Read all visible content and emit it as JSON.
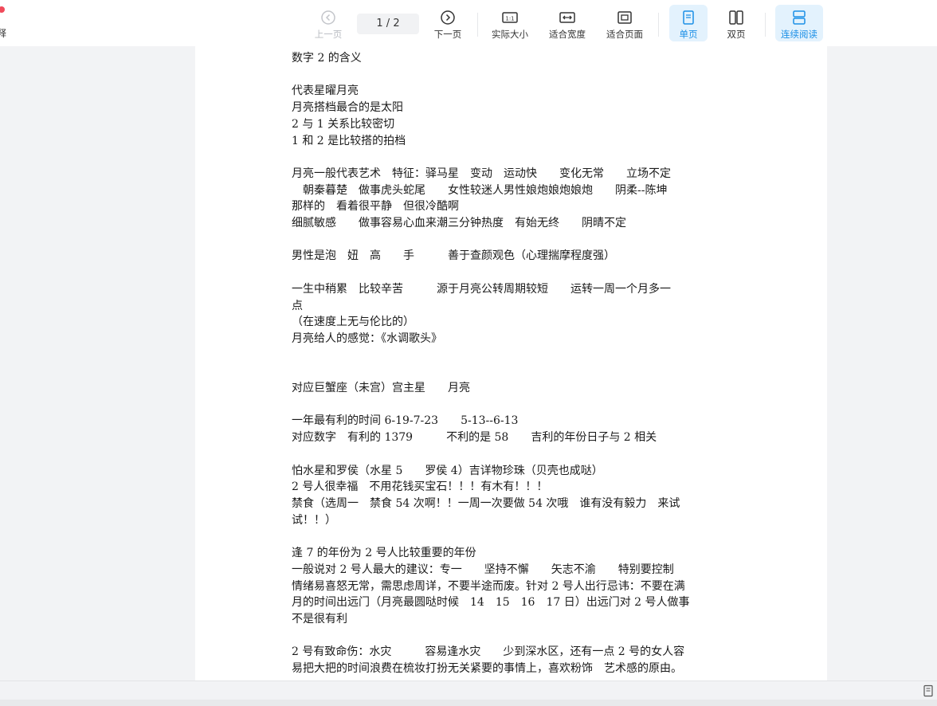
{
  "app": {
    "fragment_label": "释",
    "dot_color": "#f04a5a"
  },
  "toolbar": {
    "prev_page": "上一页",
    "page_indicator": "1 / 2",
    "next_page": "下一页",
    "actual_size": "实际大小",
    "fit_width": "适合宽度",
    "fit_page": "适合页面",
    "single_page": "单页",
    "double_page": "双页",
    "continuous_read": "连续阅读",
    "accent_color": "#1b8fe6"
  },
  "document": {
    "text": "数字 2 的含义\n\n代表星曜月亮\n月亮搭档最合的是太阳\n2 与 1 关系比较密切\n1 和 2 是比较搭的拍档\n\n月亮一般代表艺术　特征：驿马星　变动　运动快　　变化无常　　立场不定\n　朝秦暮楚　做事虎头蛇尾　　女性较迷人男性娘炮娘炮娘炮　　阴柔--陈坤\n那样的　看着很平静　但很冷酷啊\n细腻敏感　　做事容易心血来潮三分钟热度　有始无终　　阴晴不定\n\n男性是泡　妞　高　　手　　　善于查颜观色（心理揣摩程度强）\n\n一生中稍累　比较辛苦　　　源于月亮公转周期较短　　运转一周一个月多一\n点\n（在速度上无与伦比的）\n月亮给人的感觉：《水调歌头》\n\n\n对应巨蟹座（未宫）宫主星　　月亮\n\n一年最有利的时间 6-19-7-23　　5-13--6-13\n对应数字　有利的 1379　　　不利的是 58　　吉利的年份日子与 2 相关\n\n怕水星和罗侯（水星 5　　罗侯 4）吉详物珍珠（贝壳也成哒）\n2 号人很幸福　不用花钱买宝石！！！有木有！！！\n禁食（选周一　禁食 54 次啊！！一周一次要做 54 次哦　谁有没有毅力　来试\n试！！）\n\n逢 7 的年份为 2 号人比较重要的年份\n一般说对 2 号人最大的建议：专一　　坚持不懈　　矢志不渝　　特别要控制\n情绪易喜怒无常，需思虑周详，不要半途而废。针对 2 号人出行忌讳：不要在满\n月的时间出远门（月亮最圆哒时候　14　15　16　17 日）出远门对 2 号人做事\n不是很有利\n\n2 号有致命伤：水灾　　　容易逢水灾　　少到深水区，还有一点 2 号的女人容\n易把大把的时间浪费在梳妆打扮无关紧要的事情上，喜欢粉饰　艺术感的原由。"
  }
}
